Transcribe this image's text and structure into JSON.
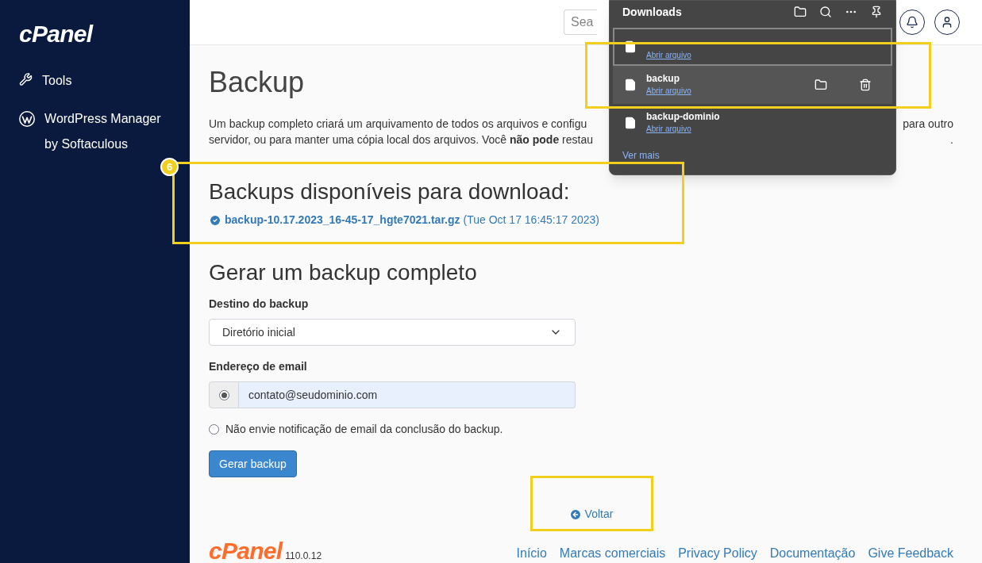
{
  "sidebar": {
    "logo": "cPanel",
    "items": [
      {
        "label": "Tools",
        "kind": "tools"
      },
      {
        "label": "WordPress Manager by Softaculous",
        "kind": "wordpress"
      }
    ]
  },
  "header": {
    "search": {
      "placeholder": "Sea"
    }
  },
  "page": {
    "title": "Backup",
    "description_lines": [
      {
        "left": "Um backup completo criará um arquivamento de todos os arquivos e configu",
        "right": "para outro"
      },
      {
        "left": "servidor, ou para manter uma cópia local dos arquivos. Você **não pode** restau",
        "right": "."
      }
    ],
    "available": {
      "title": "Backups disponíveis para download:",
      "file": "backup-10.17.2023_16-45-17_hgte7021.tar.gz",
      "date": "(Tue Oct 17 16:45:17 2023)"
    },
    "generate": {
      "title": "Gerar um backup completo",
      "destination": {
        "label": "Destino do backup",
        "value": "Diretório inicial"
      },
      "email": {
        "label": "Endereço de email",
        "value": "contato@seudominio.com",
        "selected": true
      },
      "no_notify": {
        "label": "Não envie notificação de email da conclusão do backup.",
        "selected": false
      },
      "button": "Gerar backup"
    },
    "back_link": "Voltar"
  },
  "footer": {
    "logo": "cPanel",
    "version": "110.0.12",
    "links": [
      "Início",
      "Marcas comerciais",
      "Privacy Policy",
      "Documentação",
      "Give Feedback"
    ]
  },
  "downloads_panel": {
    "title": "Downloads",
    "items": [
      {
        "link": "Abrir arquivo",
        "selected": true,
        "hovered": false
      },
      {
        "name": "backup",
        "link": "Abrir arquivo",
        "selected": false,
        "hovered": true
      },
      {
        "name": "backup-dominio",
        "link": "Abrir arquivo",
        "selected": false,
        "hovered": false
      }
    ],
    "more": "Ver mais"
  },
  "annotation": {
    "badge": "6"
  }
}
